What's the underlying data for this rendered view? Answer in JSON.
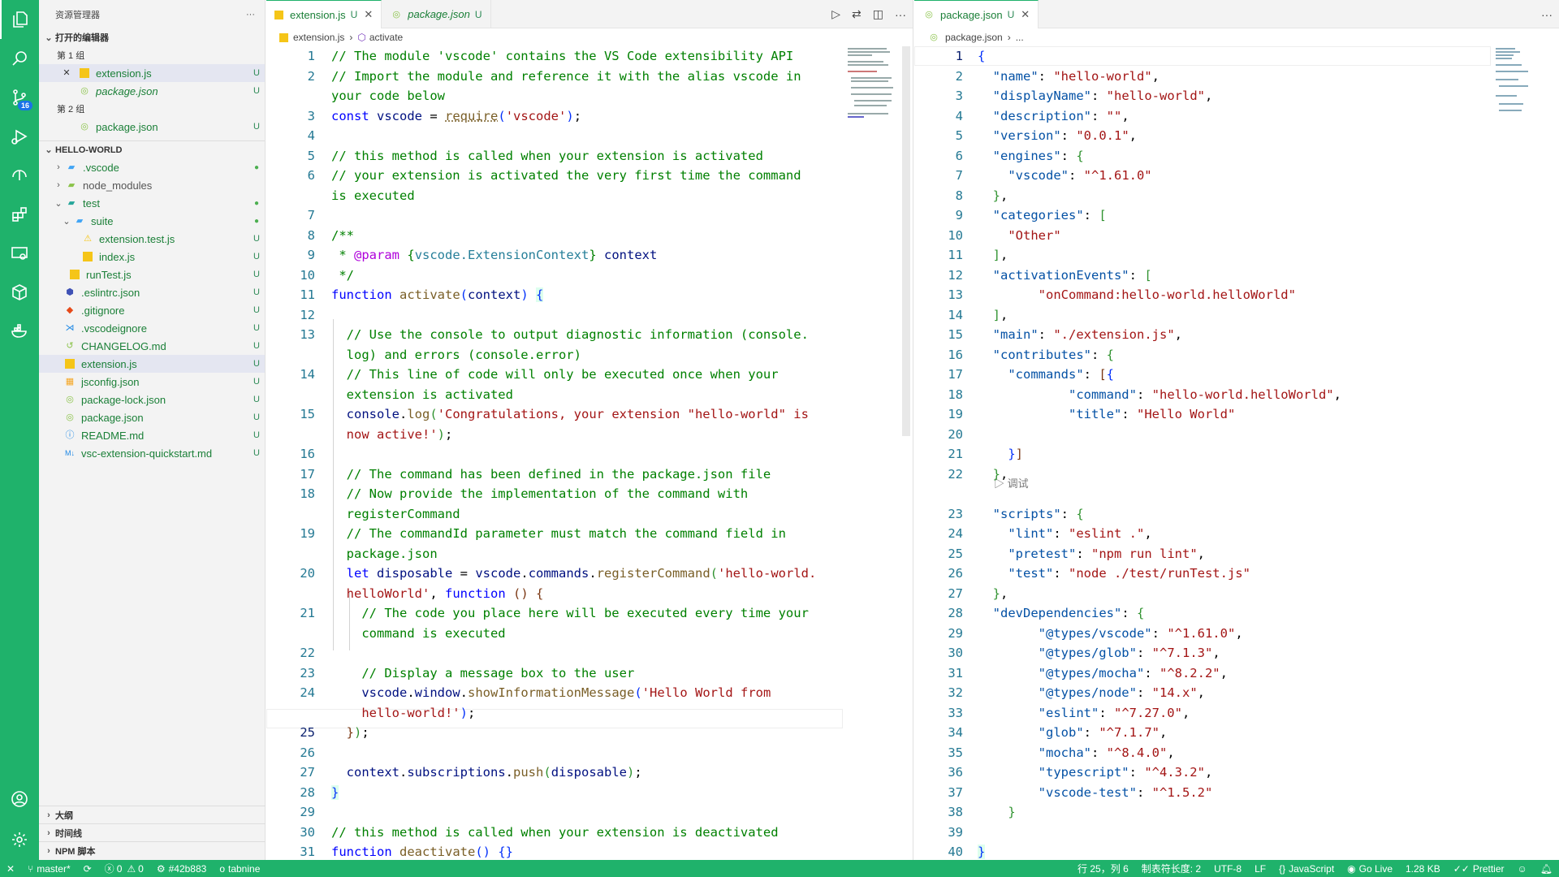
{
  "sidebar": {
    "title": "资源管理器",
    "more": "···",
    "open_editors": "打开的编辑器",
    "group1": "第 1 组",
    "group2": "第 2 组",
    "open1": [
      {
        "name": "extension.js",
        "status": "U"
      },
      {
        "name": "package.json",
        "status": "U"
      }
    ],
    "open2": [
      {
        "name": "package.json",
        "status": "U"
      }
    ],
    "project": "HELLO-WORLD",
    "tree": [
      {
        "name": ".vscode",
        "status": "●"
      },
      {
        "name": "node_modules",
        "status": ""
      },
      {
        "name": "test",
        "status": "●"
      },
      {
        "name": "suite",
        "status": "●"
      },
      {
        "name": "extension.test.js",
        "status": "U"
      },
      {
        "name": "index.js",
        "status": "U"
      },
      {
        "name": "runTest.js",
        "status": "U"
      },
      {
        "name": ".eslintrc.json",
        "status": "U"
      },
      {
        "name": ".gitignore",
        "status": "U"
      },
      {
        "name": ".vscodeignore",
        "status": "U"
      },
      {
        "name": "CHANGELOG.md",
        "status": "U"
      },
      {
        "name": "extension.js",
        "status": "U"
      },
      {
        "name": "jsconfig.json",
        "status": "U"
      },
      {
        "name": "package-lock.json",
        "status": "U"
      },
      {
        "name": "package.json",
        "status": "U"
      },
      {
        "name": "README.md",
        "status": "U"
      },
      {
        "name": "vsc-extension-quickstart.md",
        "status": "U"
      }
    ],
    "outline": "大纲",
    "timeline": "时间线",
    "npm": "NPM 脚本"
  },
  "activity": {
    "scm_badge": "16"
  },
  "left_editor": {
    "tab1": "extension.js",
    "tab1_status": "U",
    "tab2": "package.json",
    "tab2_status": "U",
    "crumb_file": "extension.js",
    "crumb_symbol": "activate"
  },
  "right_editor": {
    "tab": "package.json",
    "tab_status": "U",
    "crumb_file": "package.json",
    "crumb_more": "...",
    "codelens": "▷ 调试"
  },
  "status": {
    "branch": "master*",
    "errors": "0",
    "warnings": "0",
    "commit": "#42b883",
    "tabnine": "tabnine",
    "position": "行 25，列 6",
    "tabsize": "制表符长度: 2",
    "encoding": "UTF-8",
    "eol": "LF",
    "language": "JavaScript",
    "golive": "Go Live",
    "size": "1.28 KB",
    "prettier": "Prettier"
  },
  "colors": {
    "accent": "#1fb26b"
  }
}
